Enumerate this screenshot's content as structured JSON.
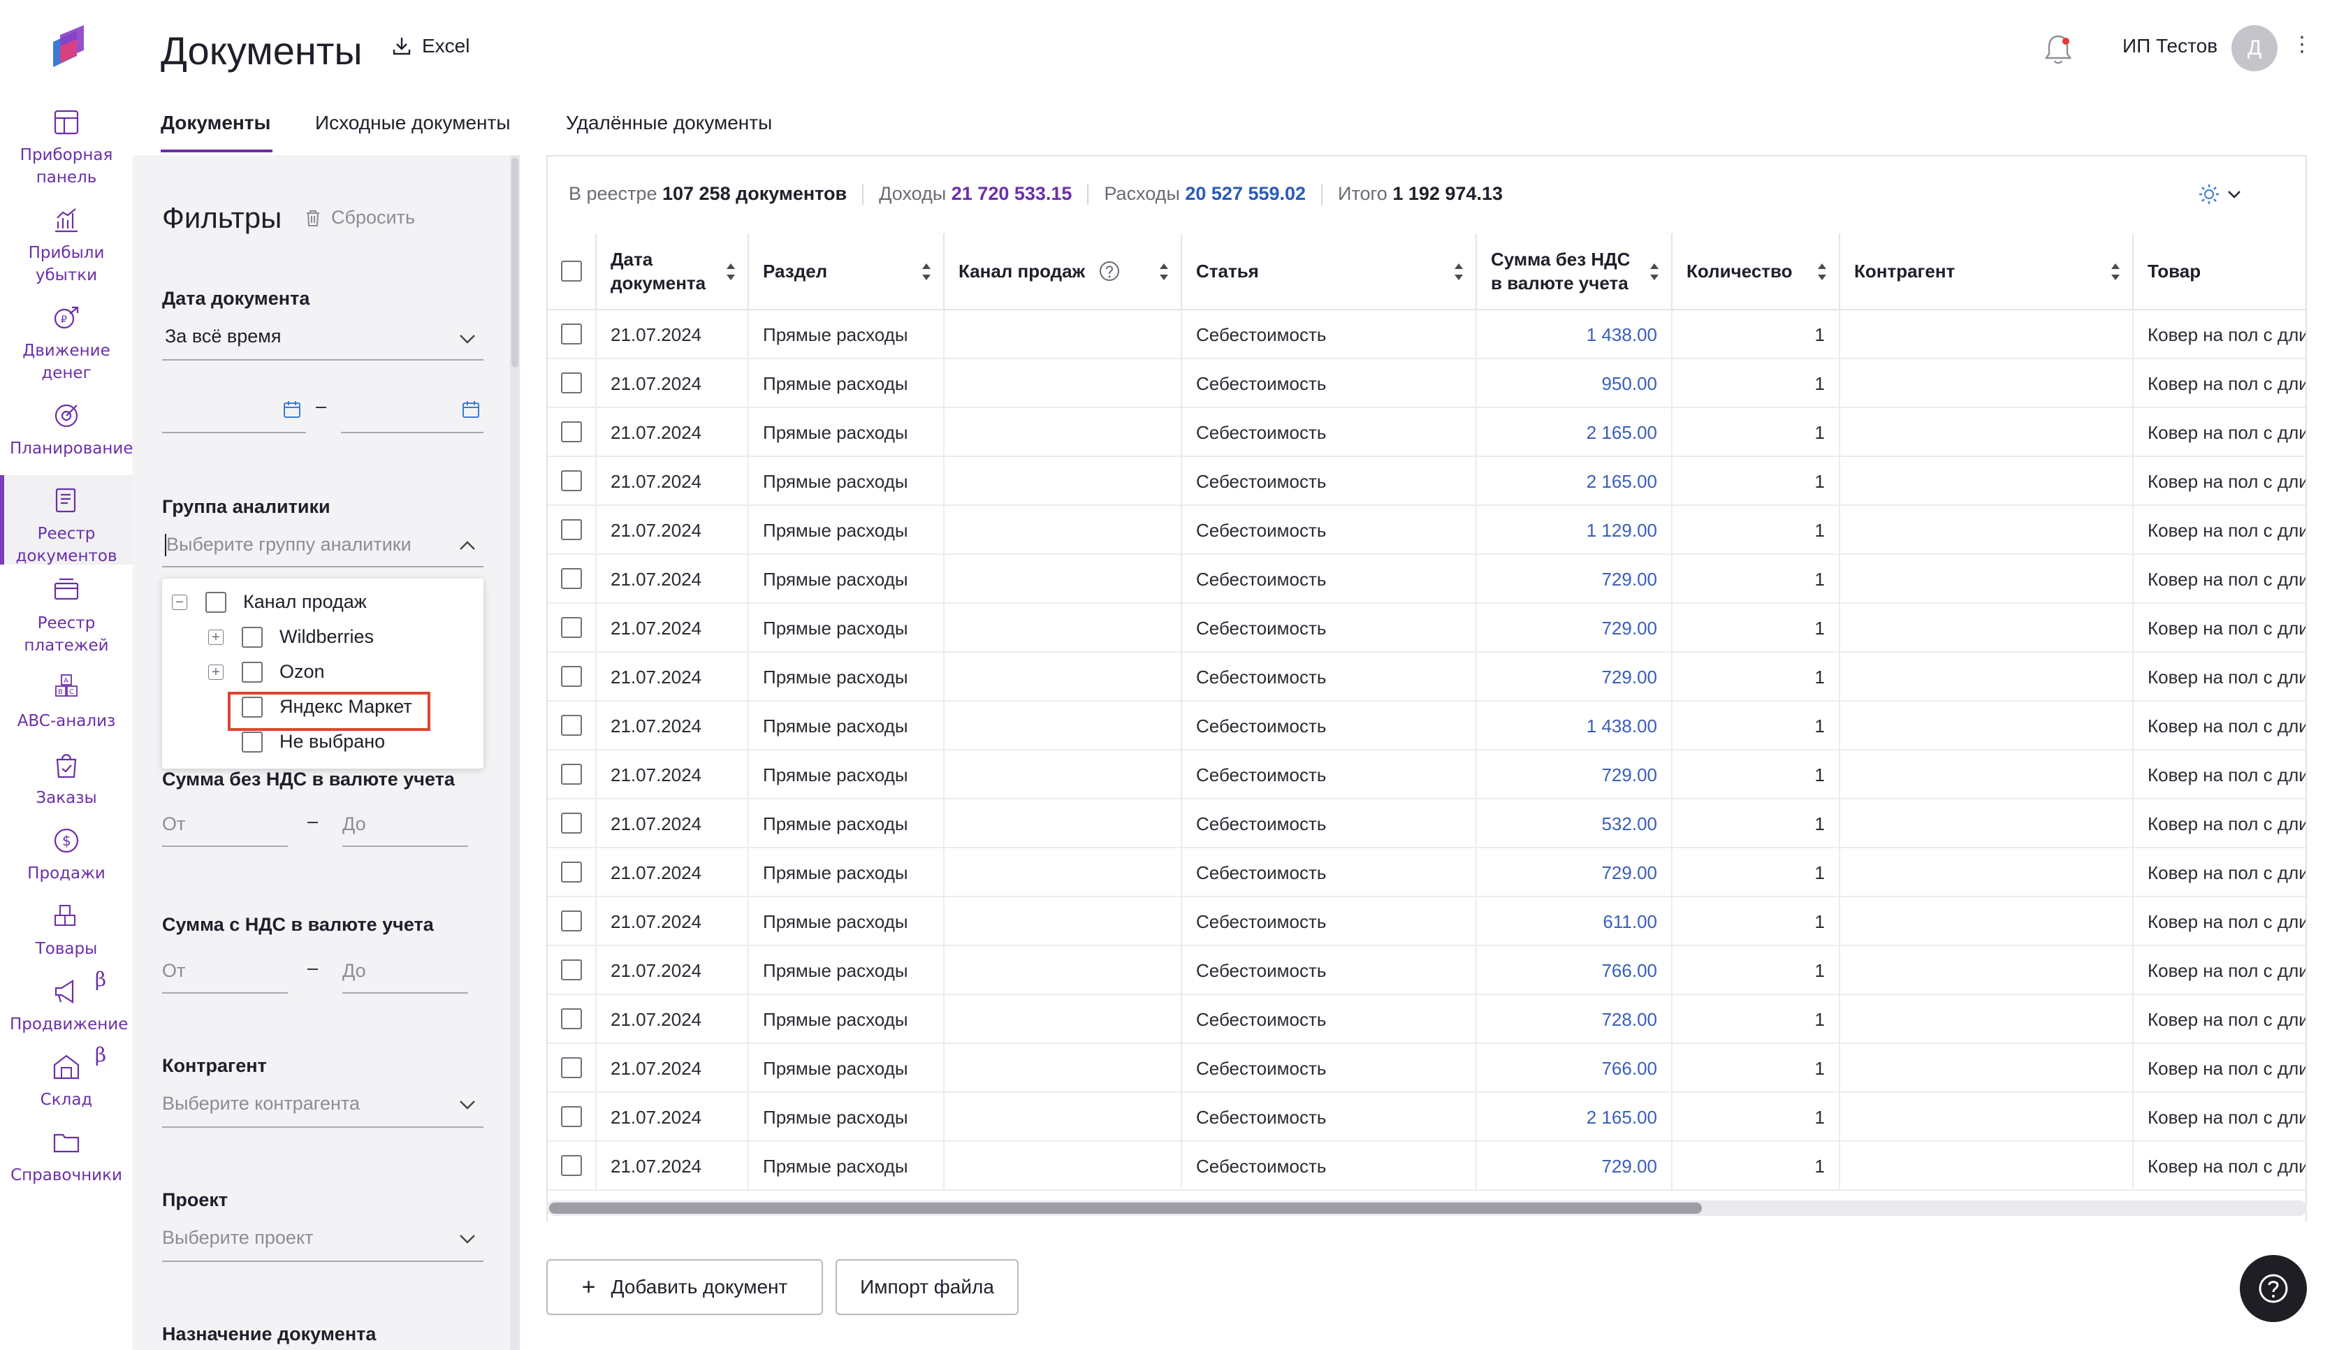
{
  "header": {
    "title": "Документы",
    "excel_label": "Excel",
    "user_name": "ИП Тестов",
    "avatar_letter": "Д"
  },
  "nav": {
    "items": [
      {
        "label": "Приборная панель",
        "icon": "dashboard-icon"
      },
      {
        "label": "Прибыли убытки",
        "icon": "profit-loss-icon"
      },
      {
        "label": "Движение денег",
        "icon": "cash-flow-icon"
      },
      {
        "label": "Планирование",
        "icon": "planning-icon"
      },
      {
        "label": "Реестр документов",
        "icon": "documents-registry-icon",
        "active": true
      },
      {
        "label": "Реестр платежей",
        "icon": "payments-registry-icon"
      },
      {
        "label": "ABC-анализ",
        "icon": "abc-analysis-icon"
      },
      {
        "label": "Заказы",
        "icon": "orders-icon"
      },
      {
        "label": "Продажи",
        "icon": "sales-icon"
      },
      {
        "label": "Товары",
        "icon": "products-icon"
      },
      {
        "label": "Продвижение",
        "icon": "promotion-icon",
        "beta": "β"
      },
      {
        "label": "Склад",
        "icon": "warehouse-icon",
        "beta": "β"
      },
      {
        "label": "Справочники",
        "icon": "references-icon"
      }
    ]
  },
  "tabs": [
    {
      "label": "Документы",
      "active": true
    },
    {
      "label": "Исходные документы"
    },
    {
      "label": "Удалённые документы"
    }
  ],
  "filters": {
    "title": "Фильтры",
    "reset_label": "Сбросить",
    "doc_date_label": "Дата документа",
    "doc_date_value": "За всё время",
    "date_dash": "–",
    "analytics_label": "Группа аналитики",
    "analytics_placeholder": "Выберите группу аналитики",
    "dropdown": {
      "root": "Канал продаж",
      "children": [
        "Wildberries",
        "Ozon",
        "Яндекс Маркет",
        "Не выбрано"
      ]
    },
    "sum_no_vat_label": "Сумма без НДС в валюте учета",
    "sum_vat_label": "Сумма с НДС в валюте учета",
    "from_placeholder": "От",
    "to_placeholder": "До",
    "range_dash": "–",
    "counterparty_label": "Контрагент",
    "counterparty_placeholder": "Выберите контрагента",
    "project_label": "Проект",
    "project_placeholder": "Выберите проект",
    "purpose_label": "Назначение документа"
  },
  "summary": {
    "registry_prefix": "В реестре",
    "registry_count": "107 258 документов",
    "income_label": "Доходы",
    "income_value": "21 720 533.15",
    "expense_label": "Расходы",
    "expense_value": "20 527 559.02",
    "total_label": "Итого",
    "total_value": "1 192 974.13"
  },
  "table": {
    "columns": [
      "Дата документа",
      "Раздел",
      "Канал продаж",
      "Статья",
      "Сумма без НДС в валюте учета",
      "Количество",
      "Контрагент",
      "Товар"
    ],
    "rows": [
      [
        "21.07.2024",
        "Прямые расходы",
        "",
        "Себестоимость",
        "1 438.00",
        "1",
        "",
        "Ковер на пол с дли"
      ],
      [
        "21.07.2024",
        "Прямые расходы",
        "",
        "Себестоимость",
        "950.00",
        "1",
        "",
        "Ковер на пол с дли"
      ],
      [
        "21.07.2024",
        "Прямые расходы",
        "",
        "Себестоимость",
        "2 165.00",
        "1",
        "",
        "Ковер на пол с дли"
      ],
      [
        "21.07.2024",
        "Прямые расходы",
        "",
        "Себестоимость",
        "2 165.00",
        "1",
        "",
        "Ковер на пол с дли"
      ],
      [
        "21.07.2024",
        "Прямые расходы",
        "",
        "Себестоимость",
        "1 129.00",
        "1",
        "",
        "Ковер на пол с дли"
      ],
      [
        "21.07.2024",
        "Прямые расходы",
        "",
        "Себестоимость",
        "729.00",
        "1",
        "",
        "Ковер на пол с дли"
      ],
      [
        "21.07.2024",
        "Прямые расходы",
        "",
        "Себестоимость",
        "729.00",
        "1",
        "",
        "Ковер на пол с дли"
      ],
      [
        "21.07.2024",
        "Прямые расходы",
        "",
        "Себестоимость",
        "729.00",
        "1",
        "",
        "Ковер на пол с дли"
      ],
      [
        "21.07.2024",
        "Прямые расходы",
        "",
        "Себестоимость",
        "1 438.00",
        "1",
        "",
        "Ковер на пол с дли"
      ],
      [
        "21.07.2024",
        "Прямые расходы",
        "",
        "Себестоимость",
        "729.00",
        "1",
        "",
        "Ковер на пол с дли"
      ],
      [
        "21.07.2024",
        "Прямые расходы",
        "",
        "Себестоимость",
        "532.00",
        "1",
        "",
        "Ковер на пол с дли"
      ],
      [
        "21.07.2024",
        "Прямые расходы",
        "",
        "Себестоимость",
        "729.00",
        "1",
        "",
        "Ковер на пол с дли"
      ],
      [
        "21.07.2024",
        "Прямые расходы",
        "",
        "Себестоимость",
        "611.00",
        "1",
        "",
        "Ковер на пол с дли"
      ],
      [
        "21.07.2024",
        "Прямые расходы",
        "",
        "Себестоимость",
        "766.00",
        "1",
        "",
        "Ковер на пол с дли"
      ],
      [
        "21.07.2024",
        "Прямые расходы",
        "",
        "Себестоимость",
        "728.00",
        "1",
        "",
        "Ковер на пол с дли"
      ],
      [
        "21.07.2024",
        "Прямые расходы",
        "",
        "Себестоимость",
        "766.00",
        "1",
        "",
        "Ковер на пол с дли"
      ],
      [
        "21.07.2024",
        "Прямые расходы",
        "",
        "Себестоимость",
        "2 165.00",
        "1",
        "",
        "Ковер на пол с дли"
      ],
      [
        "21.07.2024",
        "Прямые расходы",
        "",
        "Себестоимость",
        "729.00",
        "1",
        "",
        "Ковер на пол с дли"
      ]
    ]
  },
  "actions": {
    "add_doc_label": "Добавить документ",
    "import_label": "Импорт файла"
  },
  "colors": {
    "accent": "#6b2fa8",
    "amount": "#3a5fb8",
    "highlight": "#e0452e"
  }
}
